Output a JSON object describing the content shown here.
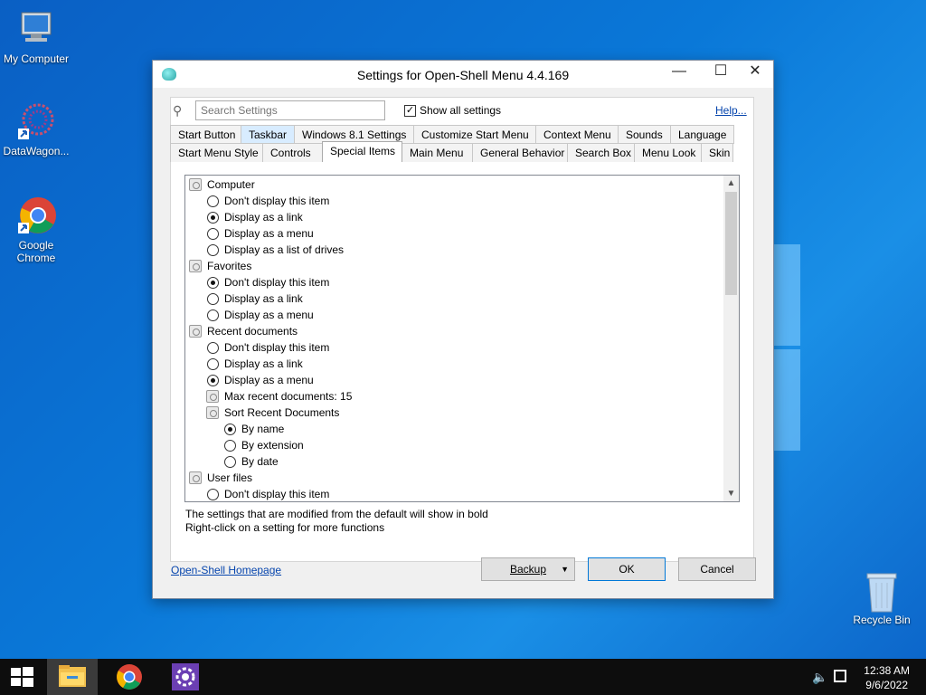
{
  "desktop": {
    "icons": [
      {
        "label": "My Computer",
        "icon": "computer-icon"
      },
      {
        "label": "DataWagon...",
        "icon": "datawagon-icon"
      },
      {
        "label": "Google Chrome",
        "icon": "chrome-icon"
      },
      {
        "label": "Recycle Bin",
        "icon": "recycle-bin-icon"
      }
    ]
  },
  "dialog": {
    "title": "Settings for Open-Shell Menu 4.4.169",
    "search_placeholder": "Search Settings",
    "show_all_label": "Show all settings",
    "show_all_checked": true,
    "help_label": "Help...",
    "tabs_row1": [
      "Start Button",
      "Taskbar",
      "Windows 8.1 Settings",
      "Customize Start Menu",
      "Context Menu",
      "Sounds",
      "Language"
    ],
    "tabs_row2": [
      "Start Menu Style",
      "Controls",
      "Special Items",
      "Main Menu",
      "General Behavior",
      "Search Box",
      "Menu Look",
      "Skin"
    ],
    "active_tab": "Special Items",
    "items": {
      "computer": {
        "label": "Computer",
        "options": [
          "Don't display this item",
          "Display as a link",
          "Display as a menu",
          "Display as a list of drives"
        ],
        "selected": 1
      },
      "favorites": {
        "label": "Favorites",
        "options": [
          "Don't display this item",
          "Display as a link",
          "Display as a menu"
        ],
        "selected": 0
      },
      "recent": {
        "label": "Recent documents",
        "options": [
          "Don't display this item",
          "Display as a link",
          "Display as a menu"
        ],
        "selected": 2,
        "max_label": "Max recent documents: 15",
        "sort_label": "Sort Recent Documents",
        "sort_options": [
          "By name",
          "By extension",
          "By date"
        ],
        "sort_selected": 0
      },
      "user_files": {
        "label": "User files",
        "options": [
          "Don't display this item"
        ]
      }
    },
    "info_line1": "The settings that are modified from the default will show in bold",
    "info_line2": "Right-click on a setting for more functions",
    "homepage_label": "Open-Shell Homepage",
    "backup_label": "Backup",
    "ok_label": "OK",
    "cancel_label": "Cancel"
  },
  "taskbar": {
    "time": "12:38 AM",
    "date": "9/6/2022"
  }
}
